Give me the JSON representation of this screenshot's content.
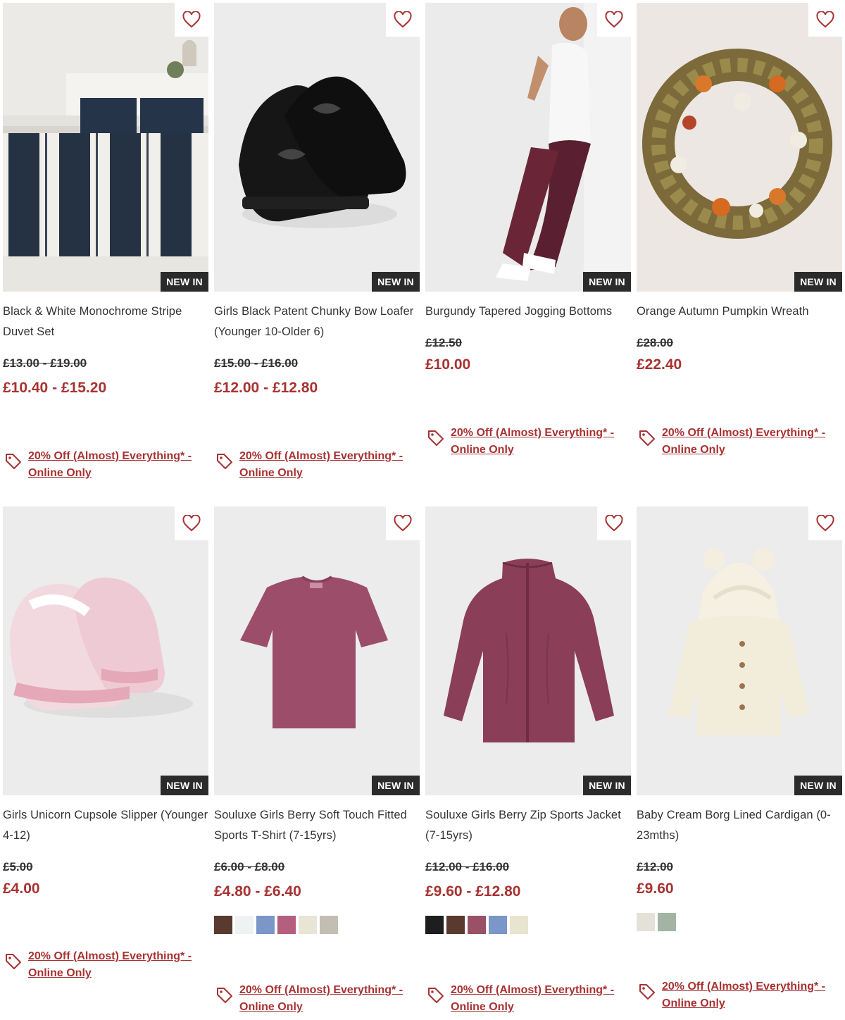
{
  "colors": {
    "accent": "#a83232",
    "badge_bg": "#2b2b2b",
    "heart": "#a83232"
  },
  "icons": {
    "wishlist": "heart-icon",
    "promo": "tag-icon"
  },
  "products": [
    {
      "name": "Black & White Monochrome Stripe Duvet Set",
      "badge": "NEW IN",
      "was_price": "£13.00 - £19.00",
      "price": "£10.40 - £15.20",
      "promo": "20% Off (Almost) Everything* - Online Only",
      "swatches": []
    },
    {
      "name": "Girls Black Patent Chunky Bow Loafer (Younger 10-Older 6)",
      "badge": "NEW IN",
      "was_price": "£15.00 - £16.00",
      "price": "£12.00 - £12.80",
      "promo": "20% Off (Almost) Everything* - Online Only",
      "swatches": []
    },
    {
      "name": "Burgundy Tapered Jogging Bottoms",
      "badge": "NEW IN",
      "was_price": "£12.50",
      "price": "£10.00",
      "promo": "20% Off (Almost) Everything* - Online Only",
      "swatches": []
    },
    {
      "name": "Orange Autumn Pumpkin Wreath",
      "badge": "NEW IN",
      "was_price": "£28.00",
      "price": "£22.40",
      "promo": "20% Off (Almost) Everything* - Online Only",
      "swatches": []
    },
    {
      "name": "Girls Unicorn Cupsole Slipper (Younger 4-12)",
      "badge": "NEW IN",
      "was_price": "£5.00",
      "price": "£4.00",
      "promo": "20% Off (Almost) Everything* - Online Only",
      "swatches": []
    },
    {
      "name": "Souluxe Girls Berry Soft Touch Fitted Sports T-Shirt (7-15yrs)",
      "badge": "NEW IN",
      "was_price": "£6.00 - £8.00",
      "price": "£4.80 - £6.40",
      "promo": "20% Off (Almost) Everything* - Online Only",
      "swatches": [
        "#5a3a2e",
        "#eef2f3",
        "#7b96c8",
        "#b55f7e",
        "#e8e4d6",
        "#c2beb2"
      ]
    },
    {
      "name": "Souluxe Girls Berry Zip Sports Jacket (7-15yrs)",
      "badge": "NEW IN",
      "was_price": "£12.00 - £16.00",
      "price": "£9.60 - £12.80",
      "promo": "20% Off (Almost) Everything* - Online Only",
      "swatches": [
        "#1e1e1e",
        "#5a3a2e",
        "#9a5066",
        "#7b96c8",
        "#e8e4cf"
      ]
    },
    {
      "name": "Baby Cream Borg Lined Cardigan (0-23mths)",
      "badge": "NEW IN",
      "was_price": "£12.00",
      "price": "£9.60",
      "promo": "20% Off (Almost) Everything* - Online Only",
      "swatches": [
        "#e3e1d8",
        "#a3b4a4"
      ]
    }
  ]
}
